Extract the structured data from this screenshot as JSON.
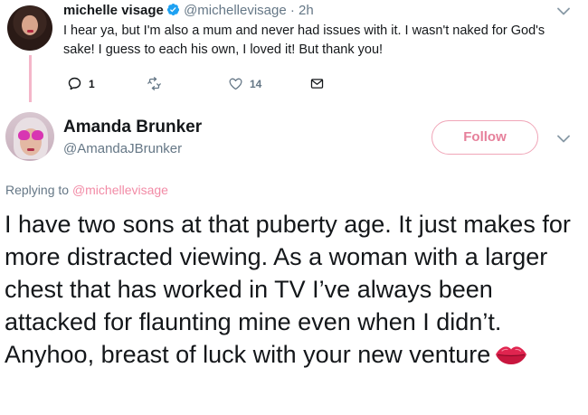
{
  "parent_tweet": {
    "display_name": "michelle visage",
    "handle": "@michellevisage",
    "separator": "·",
    "time": "2h",
    "text": "I hear ya, but I'm also a mum and never had issues with it. I wasn't naked for God's sake! I guess to each his own, I loved it! But thank you!",
    "reply_count": "1",
    "like_count": "14"
  },
  "main_tweet": {
    "display_name": "Amanda Brunker",
    "handle": "@AmandaJBrunker",
    "follow_label": "Follow",
    "replying_prefix": "Replying to",
    "replying_to": "@michellevisage",
    "text": "I have two sons at that puberty age. It just makes for more distracted viewing. As a woman with a larger chest that has worked in TV I’ve always been attacked for flaunting mine even when I didn’t. Anyhoo, breast of luck with your new venture"
  },
  "icons": {
    "verified": "verified-badge-icon",
    "reply": "reply-icon",
    "retweet": "retweet-icon",
    "like": "heart-icon",
    "dm": "envelope-icon",
    "more": "chevron-down-icon",
    "emoji": "kiss-mark-icon"
  },
  "colors": {
    "accent": "#e6809b",
    "thread_line": "#f4b6c9",
    "secondary_text": "#657786",
    "verified_blue": "#1da1f2"
  }
}
